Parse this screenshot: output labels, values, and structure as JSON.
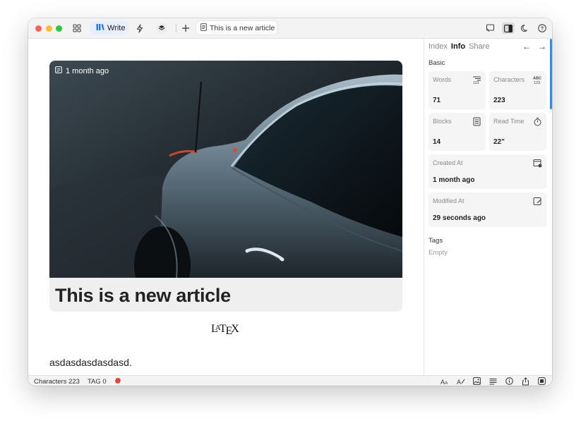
{
  "titlebar": {
    "write_label": "Write",
    "tab_title": "This is a new article"
  },
  "editor": {
    "date_badge": "1 month ago",
    "article_title": "This is a new article",
    "latex": {
      "l": "L",
      "a": "A",
      "t": "T",
      "e": "E",
      "x": "X"
    },
    "paragraph": "asdasdasdasdasd."
  },
  "sidebar": {
    "tabs": [
      "Index",
      "Info",
      "Share"
    ],
    "active_tab": "Info",
    "section": "Basic",
    "stats": {
      "words": {
        "label": "Words",
        "value": "71"
      },
      "characters": {
        "label": "Characters",
        "value": "223"
      },
      "blocks": {
        "label": "Blocks",
        "value": "14"
      },
      "read_time": {
        "label": "Read Time",
        "value": "22\""
      },
      "created_at": {
        "label": "Created At",
        "value": "1 month ago"
      },
      "modified_at": {
        "label": "Modified At",
        "value": "29 seconds ago"
      }
    },
    "tags_label": "Tags",
    "tags_empty": "Empty"
  },
  "statusbar": {
    "characters": "Characters 223",
    "tag": "TAG 0"
  },
  "colors": {
    "accent": "#2a8ef0",
    "write_bg": "#e7eefc",
    "close": "#fe5f57",
    "minimize": "#febc2e",
    "zoom": "#28c840"
  }
}
